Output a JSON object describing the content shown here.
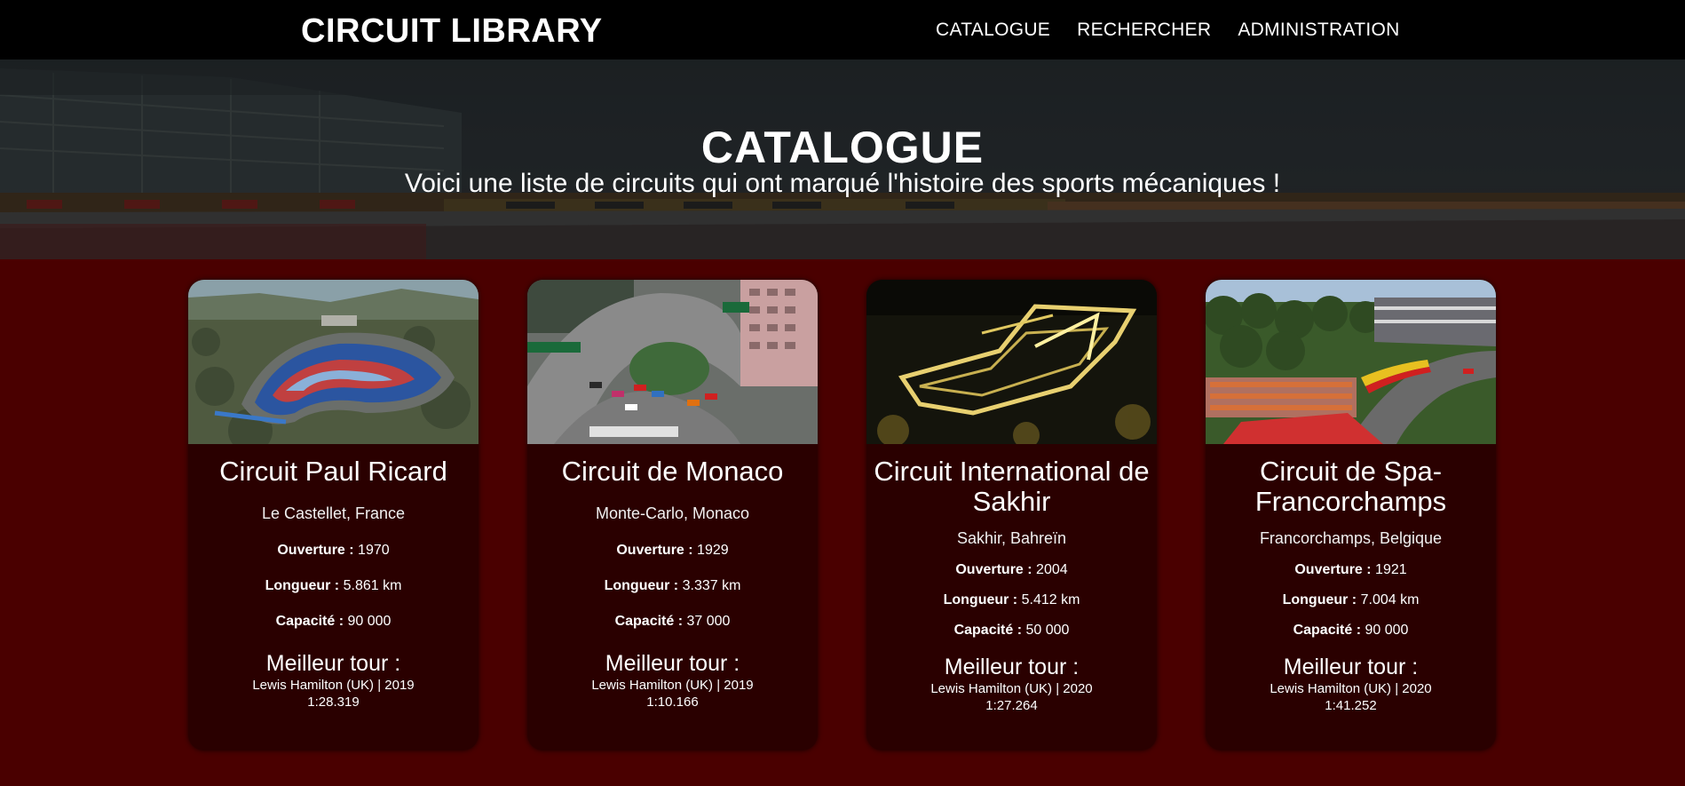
{
  "nav": {
    "brand": "CIRCUIT LIBRARY",
    "links": [
      "CATALOGUE",
      "RECHERCHER",
      "ADMINISTRATION"
    ]
  },
  "hero": {
    "title": "CATALOGUE",
    "subtitle": "Voici une liste de circuits qui ont marqué l'histoire des sports mécaniques !"
  },
  "labels": {
    "opening": "Ouverture :",
    "length": "Longueur :",
    "capacity": "Capacité :",
    "best_lap": "Meilleur tour :"
  },
  "circuits": [
    {
      "name": "Circuit Paul Ricard",
      "location": "Le Castellet, France",
      "opening": "1970",
      "length": "5.861 km",
      "capacity": "90 000",
      "best_lap_driver": "Lewis Hamilton (UK) | 2019",
      "best_lap_time": "1:28.319",
      "image": "aerial-track-photo"
    },
    {
      "name": "Circuit de Monaco",
      "location": "Monte-Carlo, Monaco",
      "opening": "1929",
      "length": "3.337 km",
      "capacity": "37 000",
      "best_lap_driver": "Lewis Hamilton (UK) | 2019",
      "best_lap_time": "1:10.166",
      "image": "street-circuit-photo"
    },
    {
      "name": "Circuit International de Sakhir",
      "location": "Sakhir, Bahreïn",
      "opening": "2004",
      "length": "5.412 km",
      "capacity": "50 000",
      "best_lap_driver": "Lewis Hamilton (UK) | 2020",
      "best_lap_time": "1:27.264",
      "image": "night-track-photo"
    },
    {
      "name": "Circuit de Spa-Francorchamps",
      "location": "Francorchamps, Belgique",
      "opening": "1921",
      "length": "7.004 km",
      "capacity": "90 000",
      "best_lap_driver": "Lewis Hamilton (UK) | 2020",
      "best_lap_time": "1:41.252",
      "image": "forest-track-photo"
    }
  ]
}
